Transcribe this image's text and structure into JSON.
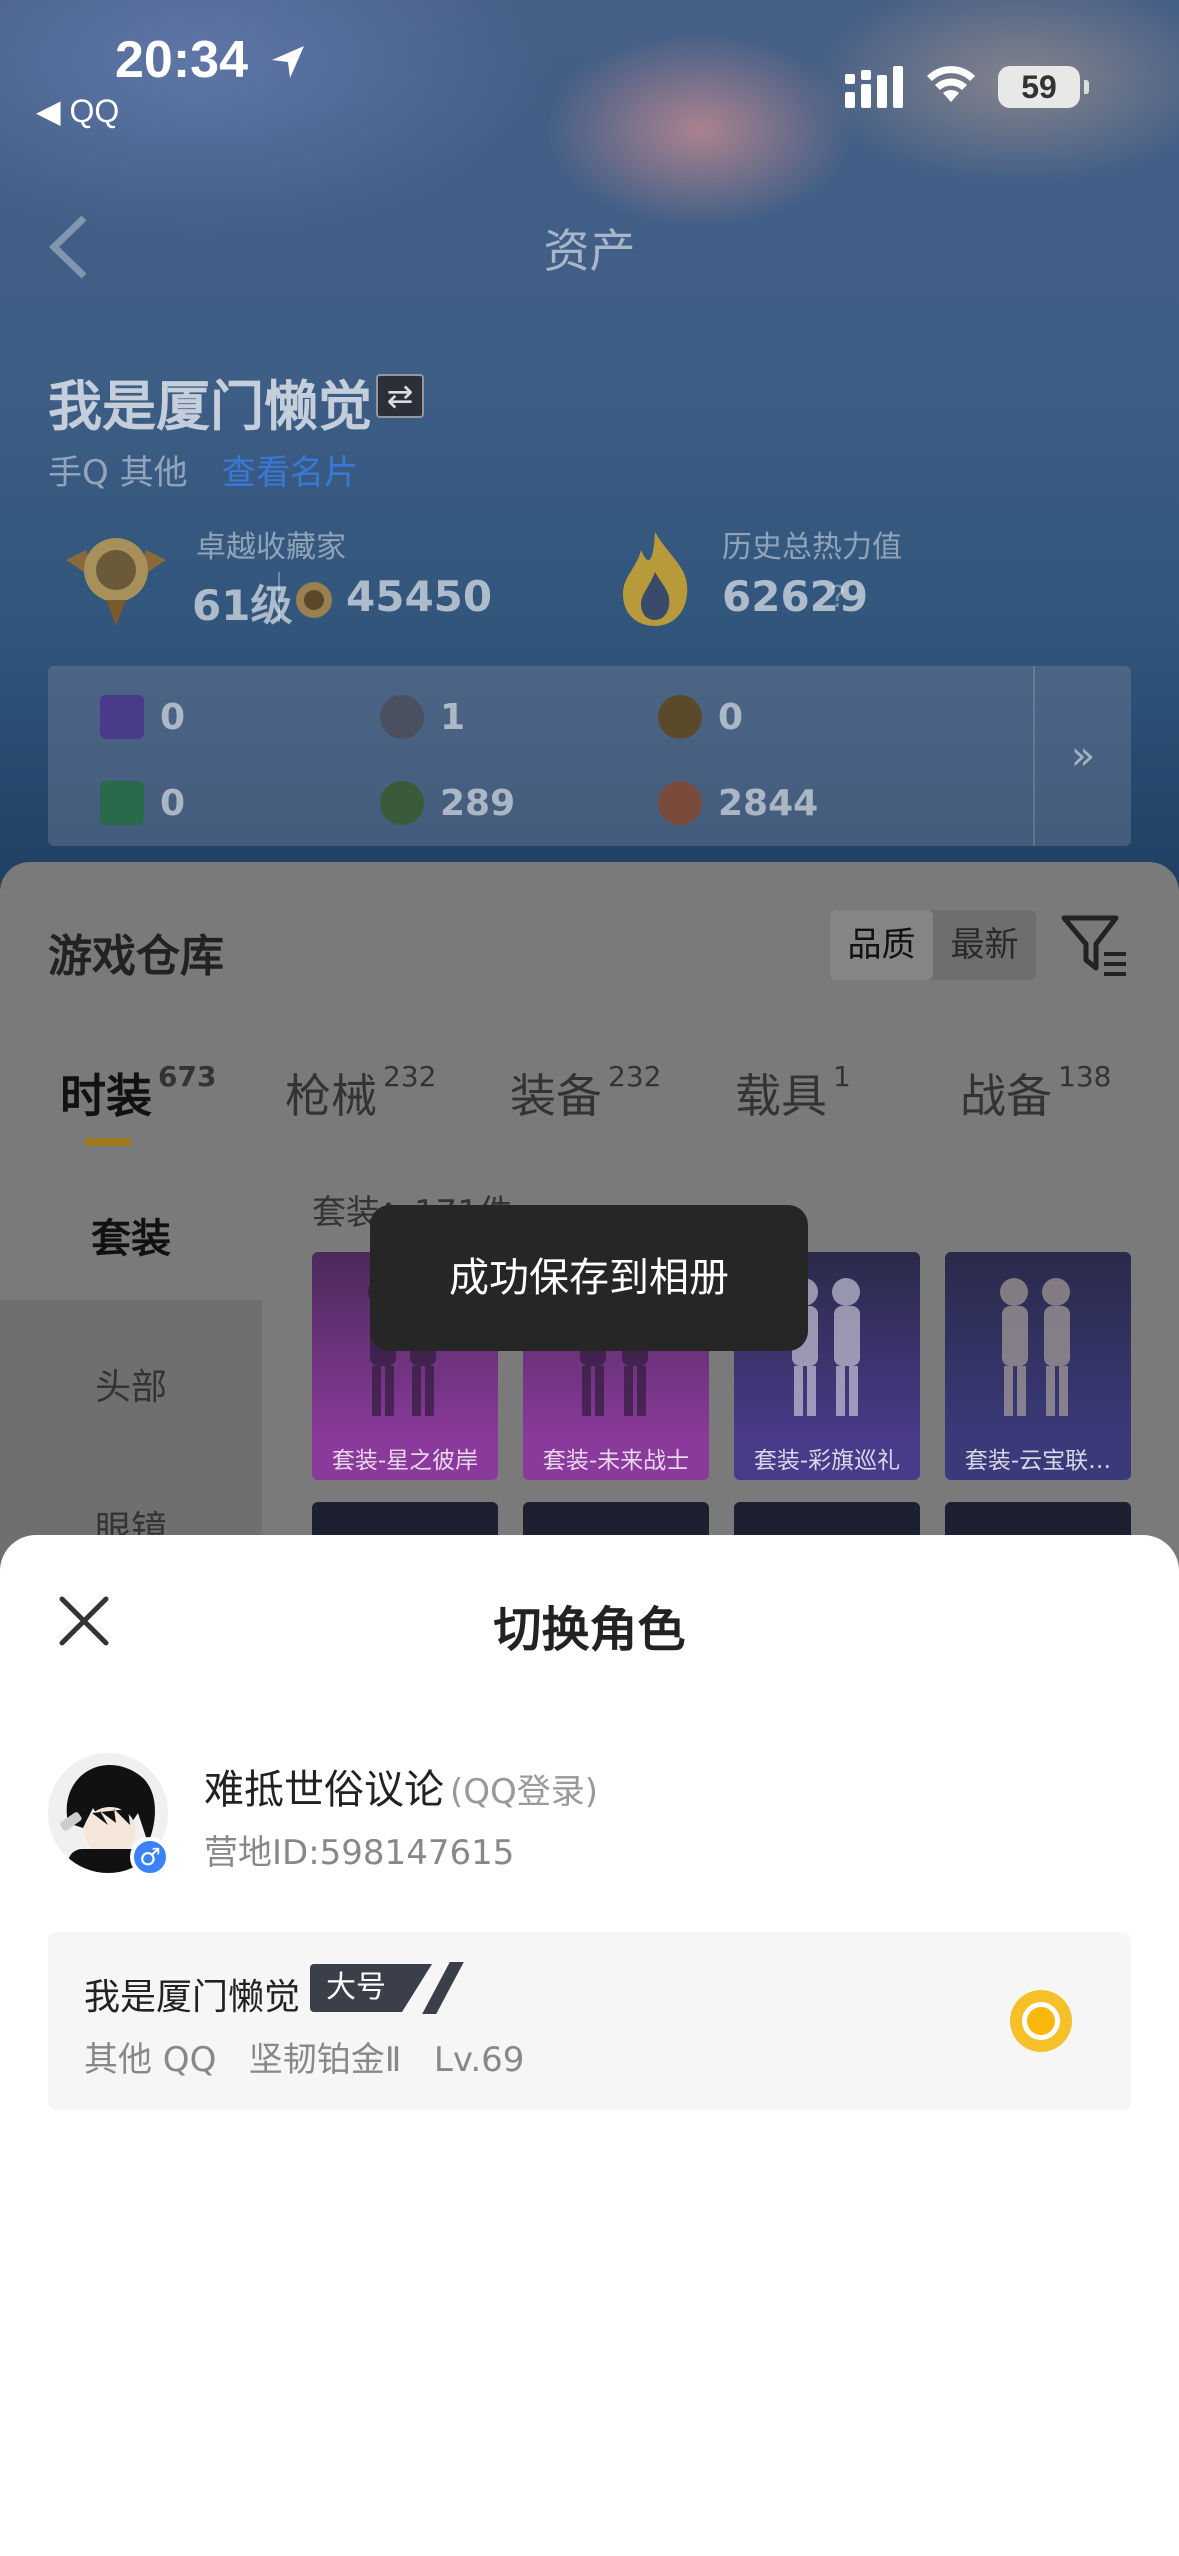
{
  "status_bar": {
    "time": "20:34",
    "back_app": "◀ QQ",
    "battery": "59"
  },
  "nav": {
    "title": "资产"
  },
  "player": {
    "name": "我是厦门懒觉",
    "sub": "手Q 其他",
    "link": "查看名片"
  },
  "stats": {
    "collector_label": "卓越收藏家",
    "collector_level": "61级",
    "collector_points": "45450",
    "heat_label": "历史总热力值",
    "heat_value": "62629",
    "help": "?"
  },
  "resources": [
    {
      "icon": "card-purple-icon",
      "value": "0",
      "color": "#4a3a8a"
    },
    {
      "icon": "coin-gray-icon",
      "value": "1",
      "color": "#4a5060"
    },
    {
      "icon": "coin-gold-icon",
      "value": "0",
      "color": "#5a4a2a"
    },
    {
      "icon": "card-green-icon",
      "value": "0",
      "color": "#2a6a4a"
    },
    {
      "icon": "orb-green-icon",
      "value": "289",
      "color": "#3a5a3a"
    },
    {
      "icon": "orb-bronze-icon",
      "value": "2844",
      "color": "#7a4a3a"
    }
  ],
  "resources_more": "»",
  "warehouse": {
    "title": "游戏仓库",
    "sort_quality": "品质",
    "sort_newest": "最新",
    "tabs": [
      {
        "label": "时装",
        "count": "673"
      },
      {
        "label": "枪械",
        "count": "232"
      },
      {
        "label": "装备",
        "count": "232"
      },
      {
        "label": "载具",
        "count": "1"
      },
      {
        "label": "战备",
        "count": "138"
      }
    ],
    "side": [
      "套装",
      "头部",
      "眼镜"
    ],
    "suit_count": "套装：171件",
    "cards": [
      {
        "label": "套装-星之彼岸",
        "bg": "#8a3a9a"
      },
      {
        "label": "套装-未来战士",
        "bg": "#8a3a9a"
      },
      {
        "label": "套装-彩旗巡礼",
        "bg": "#4a3a8a"
      },
      {
        "label": "套装-云宝联…",
        "bg": "#3a3a7a"
      }
    ]
  },
  "toast": "成功保存到相册",
  "sheet": {
    "title": "切换角色",
    "user_name": "难抵世俗议论",
    "login_type": "(QQ登录)",
    "camp_id": "营地ID:598147615",
    "gender": "♂",
    "role": {
      "name": "我是厦门懒觉",
      "badge": "大号",
      "info": "其他 QQ   坚韧铂金Ⅱ   Lv.69"
    }
  }
}
